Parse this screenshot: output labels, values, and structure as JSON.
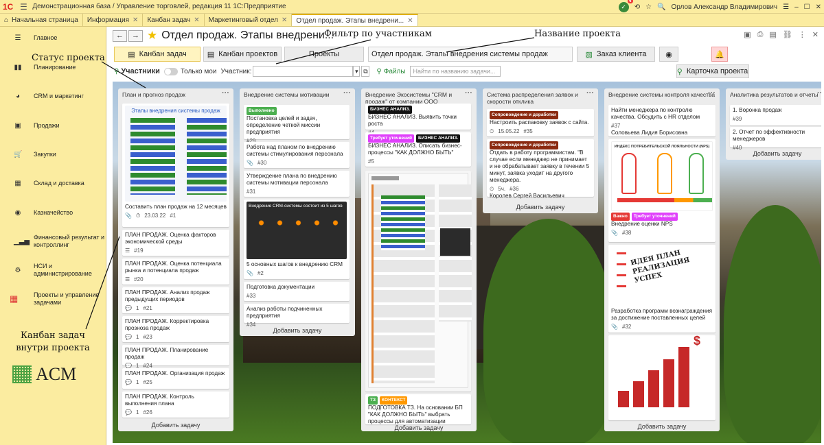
{
  "titlebar": {
    "logo": "1С",
    "title": "Демонстрационная база / Управление торговлей, редакция 11 1С:Предприятие",
    "notif_count": "4",
    "user": "Орлов Александр Владимирович"
  },
  "tabs": [
    {
      "label": "Начальная страница"
    },
    {
      "label": "Информация"
    },
    {
      "label": "Канбан задач"
    },
    {
      "label": "Маркетинговый отдел"
    },
    {
      "label": "Отдел продаж. Этапы внедрени..."
    }
  ],
  "sidebar": [
    {
      "label": "Главное",
      "icon": "menu-icon"
    },
    {
      "label": "Планирование",
      "icon": "planning-icon"
    },
    {
      "label": "CRM и маркетинг",
      "icon": "crm-icon"
    },
    {
      "label": "Продажи",
      "icon": "sales-icon"
    },
    {
      "label": "Закупки",
      "icon": "purchases-icon"
    },
    {
      "label": "Склад и доставка",
      "icon": "warehouse-icon"
    },
    {
      "label": "Казначейство",
      "icon": "treasury-icon"
    },
    {
      "label": "Финансовый результат и контроллинг",
      "icon": "finance-icon"
    },
    {
      "label": "НСИ и администрирование",
      "icon": "admin-icon"
    },
    {
      "label": "Проекты и управление задачами",
      "icon": "projects-icon"
    }
  ],
  "brand": "ACM",
  "header": {
    "title": "Отдел продаж. Этапы внедрени..."
  },
  "toolbar": {
    "kanban_tasks": "Канбан задач",
    "kanban_projects": "Канбан проектов",
    "projects": "Проекты",
    "project_name": "Отдел продаж. Этапы внедрения системы продаж",
    "client_order": "Заказ клиента"
  },
  "filters": {
    "participants": "Участники",
    "only_mine": "Только мои",
    "participant_label": "Участник:",
    "files": "Файлы",
    "search_placeholder": "Найти по названию задачи...",
    "project_card": "Карточка проекта"
  },
  "annotations": {
    "filter": "Фильтр по участникам",
    "project_name": "Название проекта",
    "status": "Статус проекта",
    "kanban": "Канбан задач внутри проекта"
  },
  "columns": [
    {
      "title": "План и прогноз продаж",
      "add": "Добавить задачу",
      "cards": [
        {
          "text": "Составить план продаж на 12 месяцев",
          "date": "23.03.22",
          "num": "#1",
          "image_caption": "Этапы внедрения системы продаж"
        },
        {
          "text": "ПЛАН ПРОДАЖ. Оценка факторов экономической среды",
          "num": "#19"
        },
        {
          "text": "ПЛАН ПРОДАЖ. Оценка потенциала рынка и потенциала продаж",
          "num": "#20"
        },
        {
          "text": "ПЛАН ПРОДАЖ. Анализ продаж предыдущих периодов",
          "count": "1",
          "num": "#21"
        },
        {
          "text": "ПЛАН ПРОДАЖ. Корректировка прозноза продаж",
          "count": "1",
          "num": "#23"
        },
        {
          "text": "ПЛАН ПРОДАЖ. Планирование продаж",
          "count": "1",
          "num": "#24"
        },
        {
          "text": "ПЛАН ПРОДАЖ. Организация продаж",
          "count": "1",
          "num": "#25"
        },
        {
          "text": "ПЛАН ПРОДАЖ. Контроль выполнения плана",
          "count": "1",
          "num": "#26"
        }
      ]
    },
    {
      "title": "Внедрение системы мотивации",
      "add": "Добавить задачу",
      "cards": [
        {
          "tag": "Выполнено",
          "text": "Постановка целей и задач, определение четкой миссии предприятия",
          "num": "#29"
        },
        {
          "text": "Работа над планом по внедрению системы стимулирования персонала",
          "num": "#30"
        },
        {
          "text": "Утверждение плана по внедрению системы мотивации персонала",
          "num": "#31"
        },
        {
          "text": "5 основных шагов к внедрению CRM",
          "num": "#2",
          "image_caption": "Внедрение CRM-системы состоит из 5 шагов"
        },
        {
          "text": "Подготовка документации",
          "num": "#33"
        },
        {
          "text": "Анализ работы подчиненных предприятия",
          "num": "#34"
        }
      ]
    },
    {
      "title": "Внедрение Экосистемы \"CRM и продаж\" от компании ООО",
      "add": "Добавить задачу",
      "cards": [
        {
          "tag": "БИЗНЕС АНАЛИЗ.",
          "text": "БИЗНЕС АНАЛИЗ. Выявить точки роста",
          "num": "#4"
        },
        {
          "tag": "Требует уточнений",
          "tag2": "БИЗНЕС АНАЛИЗ.",
          "text": "БИЗНЕС АНАЛИЗ. Описать бизнес-процессы \"КАК ДОЛЖНО БЫТЬ\"",
          "num": "#5"
        },
        {
          "tag": "ТЗ",
          "tag2": "КОНТЕКСТ",
          "text": "ПОДГОТОВКА ТЗ. На основании БП \"КАК ДОЛЖНО БЫТЬ\" выбрать процессы для автоматизации"
        }
      ]
    },
    {
      "title": "Система распределения заявок и скорости отклика",
      "add": "Добавить задачу",
      "cards": [
        {
          "tag": "Сопровождение и доработки",
          "text": "Настроить распаковку заявок с сайта.",
          "date": "15.05.22",
          "num": "#35"
        },
        {
          "tag": "Сопровождение и доработки",
          "text": "Отдать в работу программистам. \"В случае если менеджер не принимает и не обрабатывает заявку в течении 5 минут, заявка уходит на другого менеджера.",
          "hours": "5ч.",
          "num": "#36",
          "person": "Королев Сергей Васильевич"
        }
      ]
    },
    {
      "title": "Внедрение системы контроля качества",
      "add": "Добавить задачу",
      "cards": [
        {
          "text": "Найти менеджера по контролю качества. Обсудить с HR отделом",
          "num": "#37",
          "person": "Соловьева Лидия Борисовна"
        },
        {
          "tag": "Важно",
          "tag2": "Требует уточнений",
          "text": "Внедрение оценки NPS",
          "num": "#38",
          "image_caption": "ИНДЕКС ПОТРЕБИТЕЛЬСКОЙ ЛОЯЛЬНОСТИ (NPS)"
        },
        {
          "text": "Разработка программ вознаграждения за достижение поставленных целей",
          "num": "#32",
          "image_words": "ИДЕЯ ПЛАН РЕАЛИЗАЦИЯ УСПЕХ"
        }
      ]
    },
    {
      "title": "Аналитика результатов и отчеты",
      "add": "Добавить задачу",
      "cards": [
        {
          "text": "1. Воронка продаж",
          "num": "#39"
        },
        {
          "text": "2. Отчет по эффективности менеджеров",
          "num": "#40"
        }
      ]
    }
  ],
  "colors": {
    "accent": "#fbeca0",
    "done": "#4caf50",
    "black_tag": "#111111",
    "pink": "#e040fb",
    "brown": "#8b2a10",
    "red": "#e53935",
    "orange": "#ff9800",
    "green": "#2e7d32"
  }
}
